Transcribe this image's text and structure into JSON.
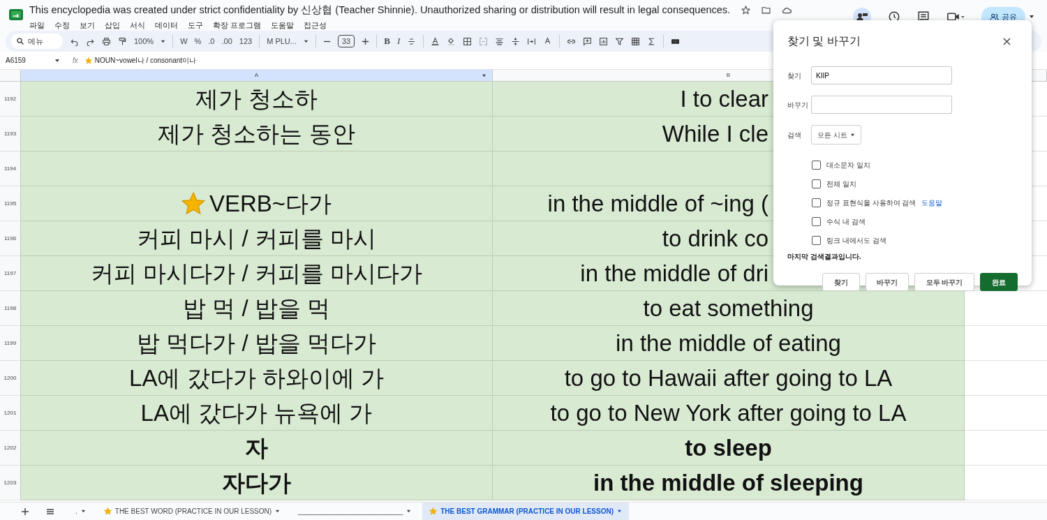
{
  "document": {
    "title": "This encyclopedia was created under strict confidentiality by 신상협 (Teacher Shinnie). Unauthorized sharing or distribution will result in legal consequences.",
    "menu": [
      "파일",
      "수정",
      "보기",
      "삽입",
      "서식",
      "데이터",
      "도구",
      "확장 프로그램",
      "도움말",
      "접근성"
    ]
  },
  "toolbar": {
    "search_placeholder": "메뉴",
    "zoom": "100%",
    "format_items": [
      "W",
      "%",
      ".0",
      ".00",
      "123"
    ],
    "font": "M PLU...",
    "font_size": "33",
    "text_buttons": [
      "B",
      "I"
    ]
  },
  "share_button": "공유",
  "formula_bar": {
    "cell_ref": "A6159",
    "fx_label": "fx",
    "formula": "NOUN~vowel나 / consonant이나",
    "starred": true
  },
  "columns": [
    {
      "label": "A",
      "selected": true
    },
    {
      "label": "B",
      "selected": false
    }
  ],
  "rows": [
    {
      "number": "1192",
      "a": "제가 청소하",
      "b": "I to clear",
      "b_cut_by_dialog": true,
      "starred": false,
      "bold": false
    },
    {
      "number": "1193",
      "a": "제가 청소하는 동안",
      "b": "While I cle",
      "b_cut_by_dialog": true,
      "starred": false,
      "bold": false
    },
    {
      "number": "1194"
    },
    {
      "number": "1195",
      "a": "VERB~다가",
      "b": "in the middle of ~ing (",
      "b_cut_by_dialog": true,
      "starred": true,
      "bold": false
    },
    {
      "number": "1196",
      "a": "커피 마시 / 커피를 마시",
      "b": "to drink co",
      "b_cut_by_dialog": true,
      "starred": false,
      "bold": false
    },
    {
      "number": "1197",
      "a": "커피 마시다가 / 커피를 마시다가",
      "b": "in the middle of dri",
      "b_cut_by_dialog": true,
      "starred": false,
      "bold": false
    },
    {
      "number": "1198",
      "a": "밥 먹 / 밥을 먹",
      "b": "to eat something",
      "starred": false,
      "bold": false
    },
    {
      "number": "1199",
      "a": "밥 먹다가 / 밥을 먹다가",
      "b": "in the middle of eating",
      "starred": false,
      "bold": false
    },
    {
      "number": "1200",
      "a": "LA에 갔다가 하와이에 가",
      "b": "to go to Hawaii after going to LA",
      "starred": false,
      "bold": false
    },
    {
      "number": "1201",
      "a": "LA에 갔다가 뉴욕에 가",
      "b": "to go to New York after going to LA",
      "starred": false,
      "bold": false
    },
    {
      "number": "1202",
      "a": "자",
      "b": "to sleep",
      "starred": false,
      "bold": true
    },
    {
      "number": "1203",
      "a": "자다가",
      "b": "in the middle of sleeping",
      "starred": false,
      "bold": true
    }
  ],
  "dialog": {
    "title": "찾기 및 바꾸기",
    "fields": [
      {
        "label": "찾기",
        "value": "KIIP"
      },
      {
        "label": "바꾸기"
      }
    ],
    "scope_label": "검색",
    "scope": "모든 시트",
    "options": [
      {
        "label": "대소문자 일치",
        "checked": false
      },
      {
        "label": "전체 일치",
        "checked": false
      },
      {
        "label": "정규 표현식을 사용하여 검색",
        "checked": false,
        "link": "도움말"
      },
      {
        "label": "수식 내 검색",
        "checked": false
      },
      {
        "label": "링크 내에서도 검색",
        "checked": false
      }
    ],
    "status": "마지막 검색결과입니다.",
    "buttons": [
      {
        "label": "찾기",
        "kind": "secondary"
      },
      {
        "label": "바꾸기",
        "kind": "secondary"
      },
      {
        "label": "모두 바꾸기",
        "kind": "secondary"
      },
      {
        "label": "완료",
        "kind": "primary"
      }
    ]
  },
  "sheet_tabs": [
    {
      "label": ".",
      "starred": false,
      "selected": false
    },
    {
      "label": "THE BEST WORD (PRACTICE IN OUR LESSON)",
      "starred": true,
      "selected": false
    },
    {
      "label": "___________________________",
      "starred": false,
      "selected": false
    },
    {
      "label": "THE BEST GRAMMAR (PRACTICE IN OUR LESSON)",
      "starred": true,
      "selected": true
    }
  ]
}
